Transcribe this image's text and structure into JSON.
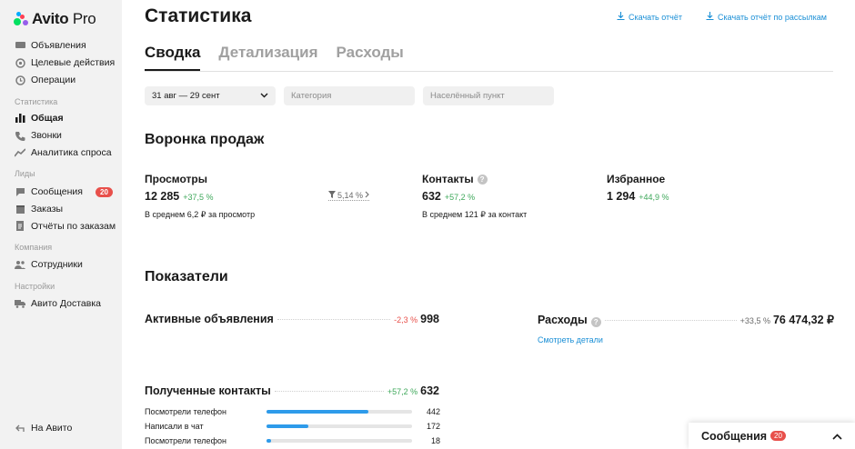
{
  "logo": {
    "brand": "Avito",
    "suffix": "Pro"
  },
  "sidebar": {
    "items": [
      {
        "label": "Объявления",
        "icon": "listings-icon"
      },
      {
        "label": "Целевые действия",
        "icon": "target-icon"
      },
      {
        "label": "Операции",
        "icon": "operations-icon"
      }
    ],
    "sections": {
      "stats": "Статистика",
      "leads": "Лиды",
      "company": "Компания",
      "settings": "Настройки"
    },
    "stats_items": [
      {
        "label": "Общая",
        "icon": "bar-chart-icon"
      },
      {
        "label": "Звонки",
        "icon": "phone-icon"
      },
      {
        "label": "Аналитика спроса",
        "icon": "trend-icon"
      }
    ],
    "leads_items": [
      {
        "label": "Сообщения",
        "icon": "chat-icon",
        "badge": "20"
      },
      {
        "label": "Заказы",
        "icon": "box-icon"
      },
      {
        "label": "Отчёты по заказам",
        "icon": "report-icon"
      }
    ],
    "company_items": [
      {
        "label": "Сотрудники",
        "icon": "people-icon"
      }
    ],
    "settings_items": [
      {
        "label": "Авито Доставка",
        "icon": "truck-icon"
      }
    ],
    "back": {
      "label": "На Авито",
      "icon": "back-arrow-icon"
    }
  },
  "header": {
    "title": "Статистика",
    "download": "Скачать отчёт",
    "download_mailing": "Скачать отчёт по рассылкам"
  },
  "tabs": [
    "Сводка",
    "Детализация",
    "Расходы"
  ],
  "filters": {
    "date": "31 авг — 29 сент",
    "category": "Категория",
    "location": "Населённый пункт"
  },
  "funnel": {
    "title": "Воронка продаж",
    "views": {
      "label": "Просмотры",
      "value": "12 285",
      "change": "+37,5 %",
      "note": "В среднем 6,2 ₽ за просмотр"
    },
    "conversion": "5,14 %",
    "contacts": {
      "label": "Контакты",
      "value": "632",
      "change": "+57,2 %",
      "note": "В среднем 121 ₽ за контакт"
    },
    "favorites": {
      "label": "Избранное",
      "value": "1 294",
      "change": "+44,9 %"
    }
  },
  "indicators": {
    "title": "Показатели",
    "active": {
      "label": "Активные объявления",
      "change": "-2,3 %",
      "value": "998"
    },
    "expenses": {
      "label": "Расходы",
      "change": "+33,5 %",
      "value": "76 474,32 ₽",
      "link": "Смотреть детали"
    },
    "contacts": {
      "label": "Полученные контакты",
      "change": "+57,2 %",
      "value": "632",
      "rows": [
        {
          "label": "Посмотрели телефон",
          "value": "442",
          "fraction": 0.7
        },
        {
          "label": "Написали в чат",
          "value": "172",
          "fraction": 0.29
        },
        {
          "label": "Посмотрели телефон",
          "value": "18",
          "fraction": 0.03
        }
      ]
    }
  },
  "messages_panel": {
    "title": "Сообщения",
    "badge": "20"
  },
  "colors": {
    "accent": "#1a8fd6",
    "positive": "#3fa85b",
    "negative": "#e8504b",
    "bar": "#2e9bea"
  }
}
